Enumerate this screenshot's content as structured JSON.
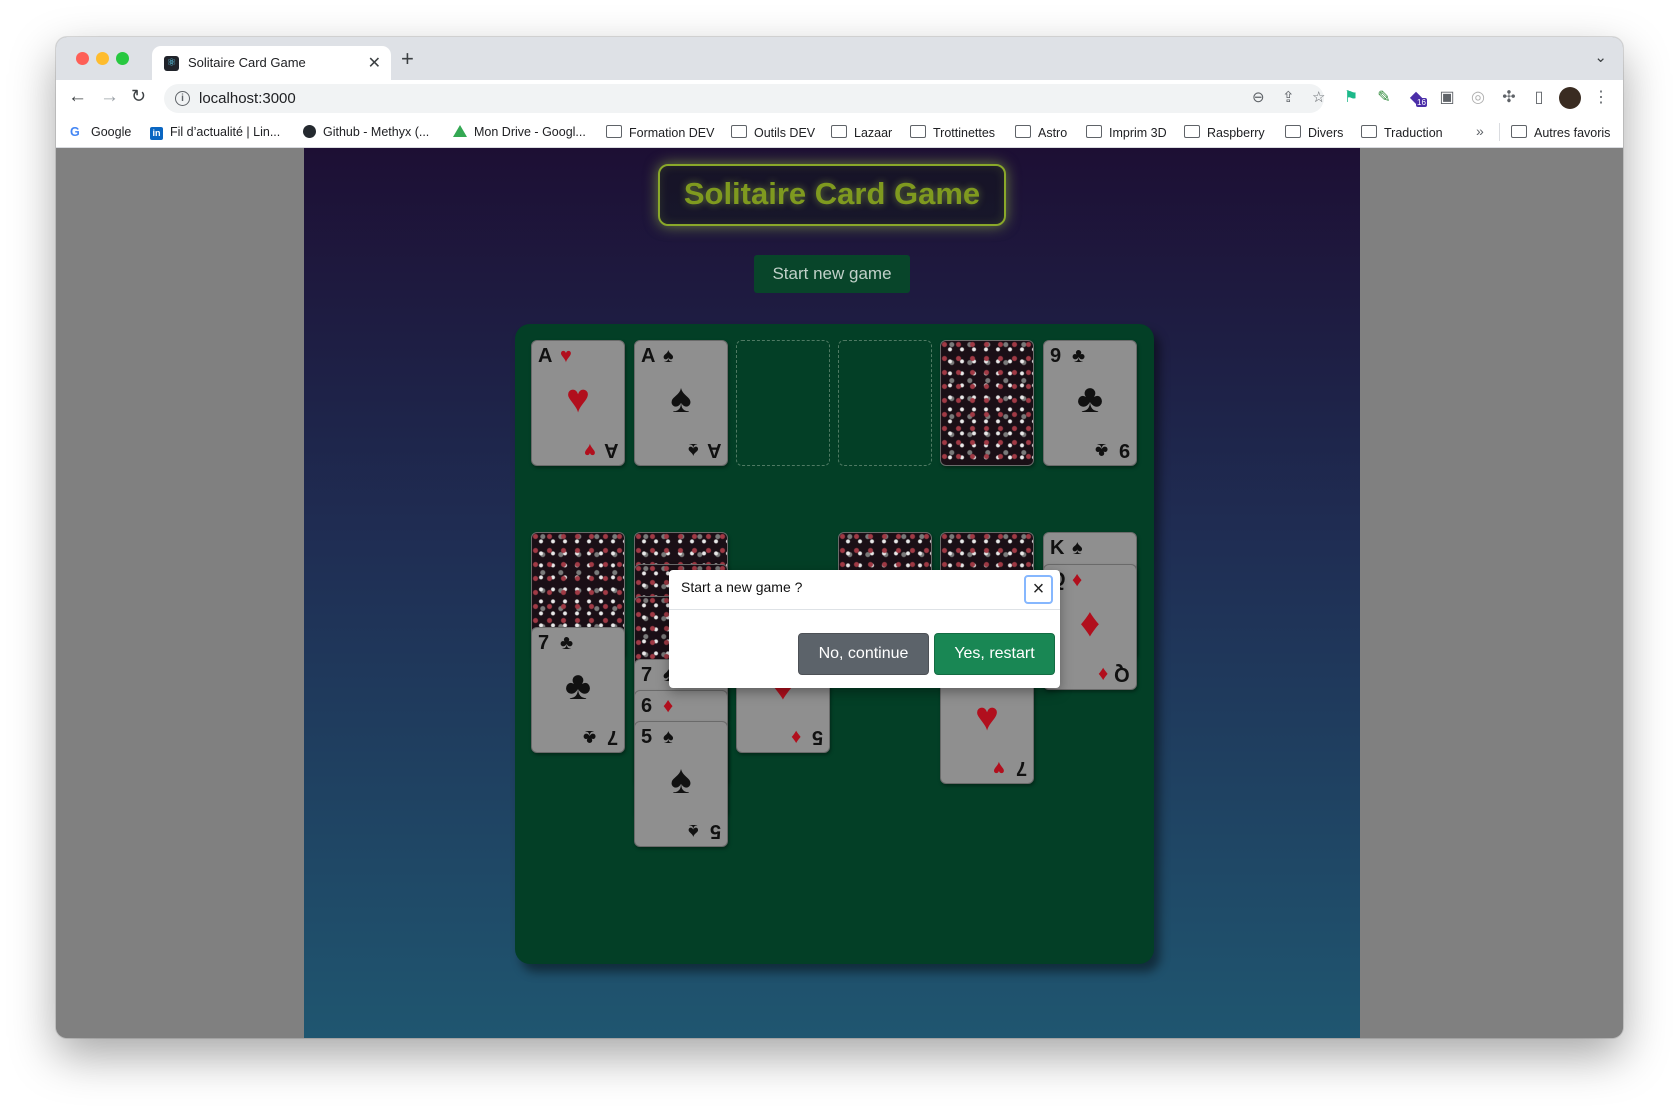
{
  "browser": {
    "tab_title": "Solitaire Card Game",
    "url": "localhost:3000",
    "bookmarks": [
      "Google",
      "Fil d’actualité | Lin...",
      "Github - Methyx (...",
      "Mon Drive - Googl...",
      "Formation DEV",
      "Outils DEV",
      "Lazaar",
      "Trottinettes",
      "Astro",
      "Imprim 3D",
      "Raspberry",
      "Divers",
      "Traduction"
    ],
    "more_bookmarks": "»",
    "other_bookmarks": "Autres favoris",
    "extension_badge": "16"
  },
  "app": {
    "title": "Solitaire Card Game",
    "start_button": "Start new game"
  },
  "foundation": [
    {
      "rank": "A",
      "suit": "♥",
      "color": "#b10f1d"
    },
    {
      "rank": "A",
      "suit": "♠",
      "color": "#111111"
    },
    null,
    null
  ],
  "waste_card": {
    "rank": "9",
    "suit": "♣",
    "color": "#111111"
  },
  "tableau_visible": [
    {
      "rank": "7",
      "suit": "♣",
      "color": "#111111"
    },
    {
      "rank": "7",
      "suit": "♠",
      "color": "#111111"
    },
    {
      "rank": "6",
      "suit": "♦",
      "color": "#b10f1d"
    },
    {
      "rank": "5",
      "suit": "♠",
      "color": "#111111"
    },
    {
      "rank": "5",
      "suit": "♦",
      "color": "#b10f1d"
    },
    {
      "rank": "7",
      "suit": "♥",
      "color": "#b10f1d"
    },
    {
      "rank": "K",
      "suit": "♠",
      "color": "#111111"
    },
    {
      "rank": "Q",
      "suit": "♦",
      "color": "#b10f1d"
    }
  ],
  "modal": {
    "title": "Start a new game ?",
    "close_icon": "×",
    "no_button": "No, continue",
    "yes_button": "Yes, restart"
  }
}
